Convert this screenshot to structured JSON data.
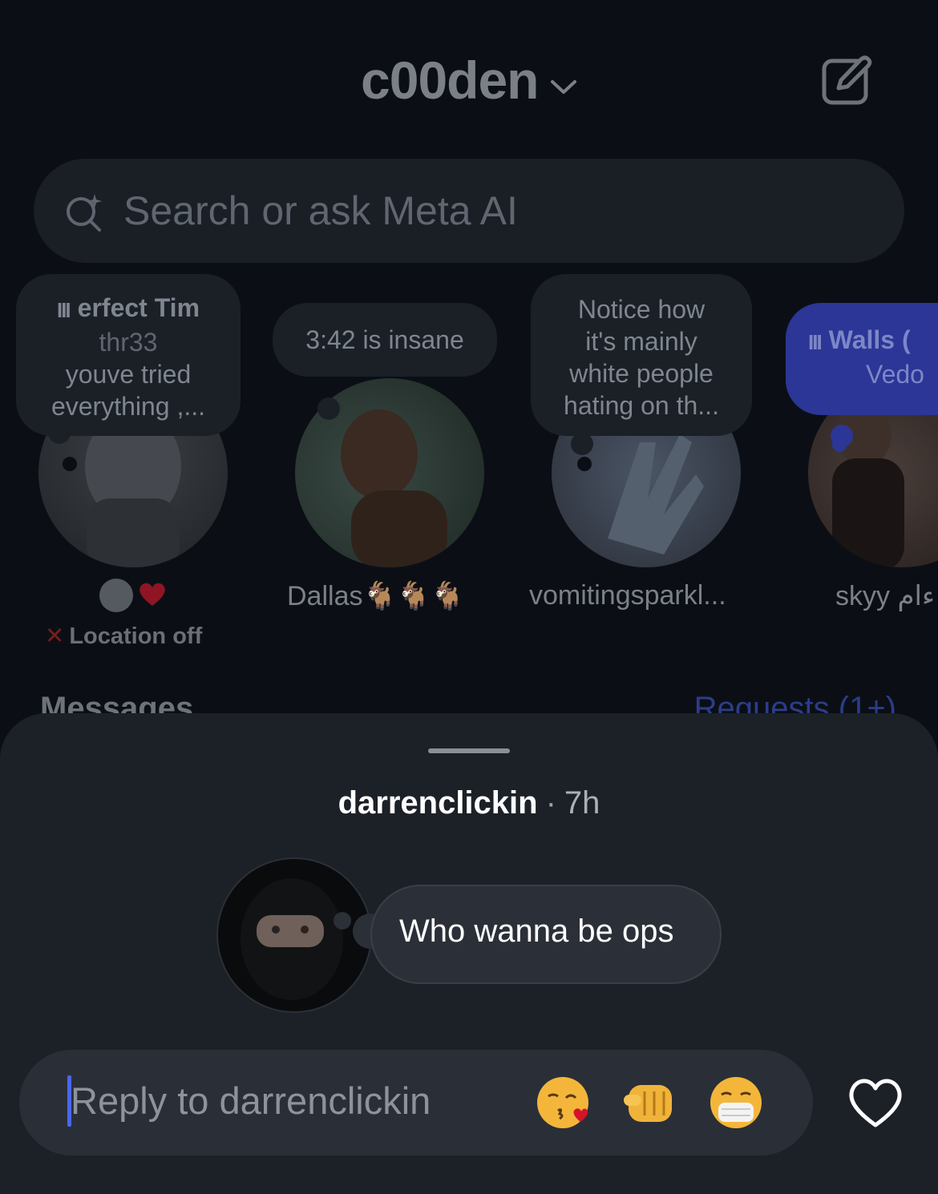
{
  "header": {
    "account_name": "c00den"
  },
  "search": {
    "placeholder": "Search or ask Meta AI"
  },
  "notes": [
    {
      "bubble_title": "erfect Tim",
      "bubble_lines": [
        "thr33",
        "youve tried",
        "everything ,..."
      ],
      "sub": "Location off"
    },
    {
      "bubble_text": "3:42 is insane",
      "name": "Dallas🐐🐐🐐"
    },
    {
      "bubble_lines": [
        "Notice how",
        "it's mainly",
        "white people",
        "hating on th..."
      ],
      "name": "vomitingsparkl..."
    },
    {
      "bubble_title": "Walls (",
      "bubble_sub": "Vedo",
      "name": "skyy ءام"
    }
  ],
  "sections": {
    "messages": "Messages",
    "requests": "Requests (1+)"
  },
  "sheet": {
    "username": "darrenclickin",
    "separator": "·",
    "time": "7h",
    "message": "Who wanna be ops",
    "reply_placeholder": "Reply to darrenclickin",
    "quick_emojis": [
      "kissing-heart-emoji",
      "pointing-fist-emoji",
      "mask-emoji"
    ]
  },
  "colors": {
    "accent_blue": "#4a67f5",
    "note_blue": "#2b3697",
    "heart_red": "#c0102a"
  }
}
